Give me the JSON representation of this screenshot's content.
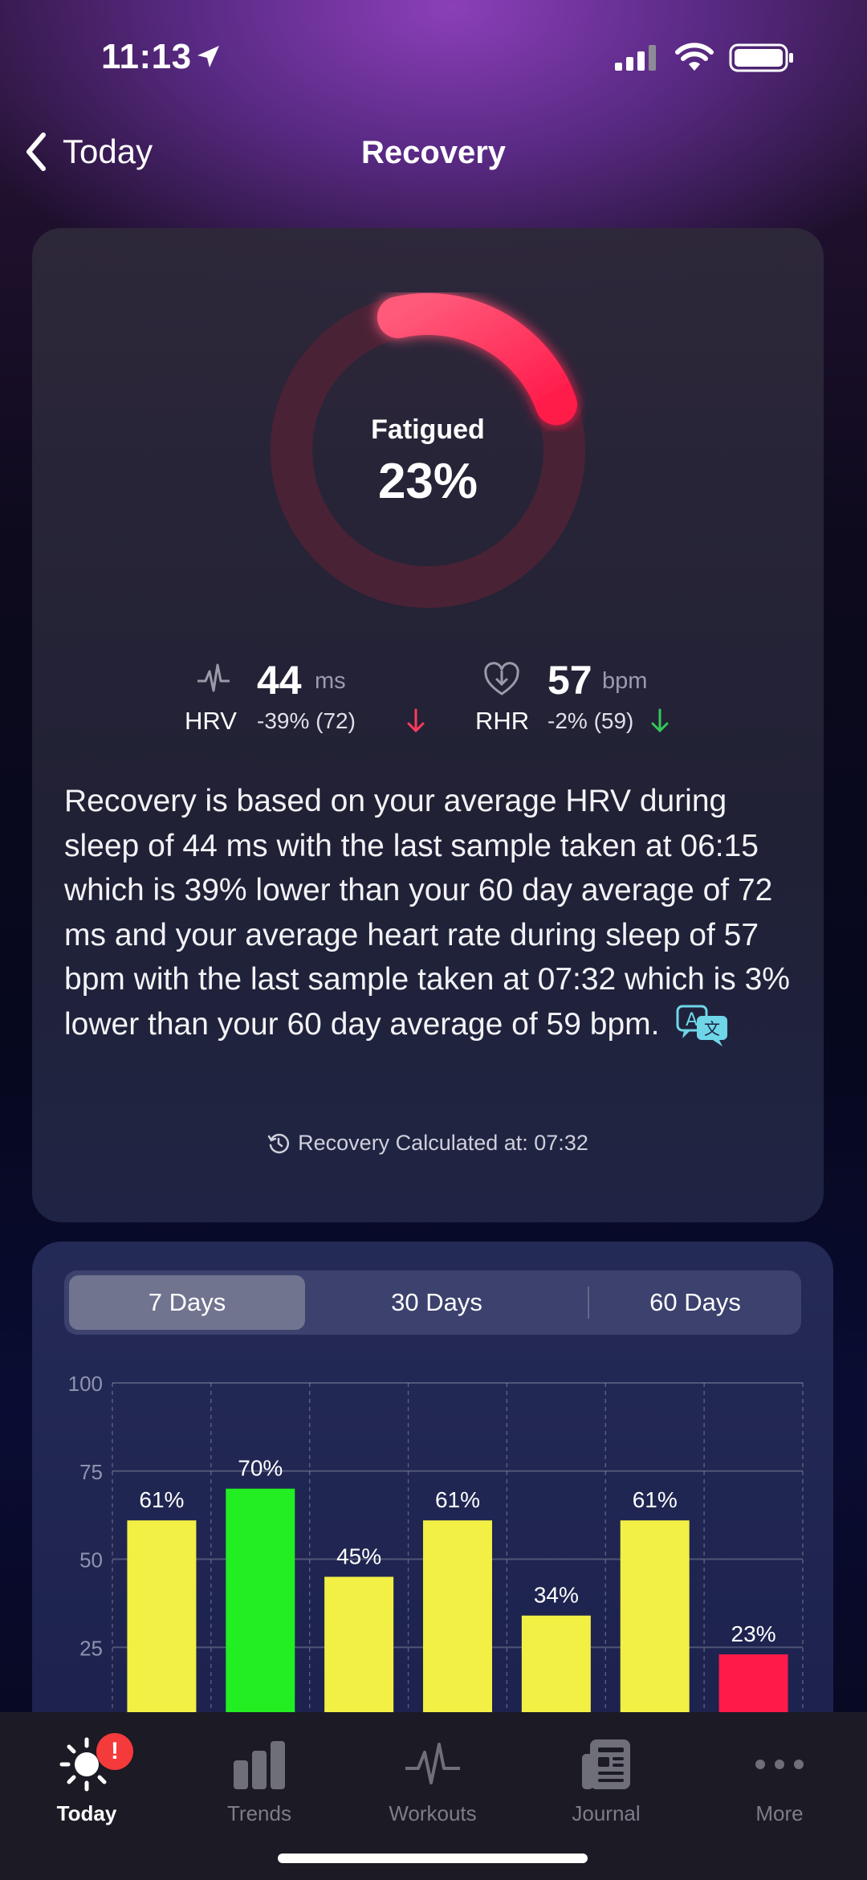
{
  "status": {
    "time": "11:13"
  },
  "nav": {
    "back_label": "Today",
    "title": "Recovery"
  },
  "recovery": {
    "state_label": "Fatigued",
    "score_label": "23%",
    "score": 0.23,
    "ring_color": "#ff2d55"
  },
  "metrics": {
    "hrv": {
      "name": "HRV",
      "value": "44",
      "unit": "ms",
      "delta": "-39% (72)",
      "trend": "down",
      "trend_color": "#ff3b5c"
    },
    "rhr": {
      "name": "RHR",
      "value": "57",
      "unit": "bpm",
      "delta": "-2% (59)",
      "trend": "down",
      "trend_color": "#34c759"
    }
  },
  "description": "Recovery is based on your average HRV during sleep of 44 ms with the last sample taken at 06:15 which is 39% lower than your 60 day average of 72 ms and your average heart rate during sleep of 57 bpm with the last sample taken at 07:32 which is 3% lower than your 60 day average of 59 bpm.",
  "calculated_at": "Recovery Calculated at: 07:32",
  "range_tabs": [
    {
      "label": "7 Days",
      "active": true
    },
    {
      "label": "30 Days",
      "active": false
    },
    {
      "label": "60 Days",
      "active": false
    }
  ],
  "chart_data": {
    "type": "bar",
    "ylim": [
      0,
      100
    ],
    "yticks": [
      "100",
      "75",
      "50",
      "25"
    ],
    "values": [
      61,
      70,
      45,
      61,
      34,
      61,
      23
    ],
    "labels": [
      "61%",
      "70%",
      "45%",
      "61%",
      "34%",
      "61%",
      "23%"
    ],
    "colors": [
      "#f2ef45",
      "#22ee22",
      "#f2ef45",
      "#f2ef45",
      "#f2ef45",
      "#f2ef45",
      "#ff1a4a"
    ],
    "grid": true
  },
  "tabbar": {
    "items": [
      {
        "label": "Today",
        "icon": "sun-icon",
        "active": true,
        "badge": "!"
      },
      {
        "label": "Trends",
        "icon": "bar-chart-icon",
        "active": false
      },
      {
        "label": "Workouts",
        "icon": "heartbeat-icon",
        "active": false
      },
      {
        "label": "Journal",
        "icon": "journal-icon",
        "active": false
      },
      {
        "label": "More",
        "icon": "more-dots-icon",
        "active": false
      }
    ]
  }
}
